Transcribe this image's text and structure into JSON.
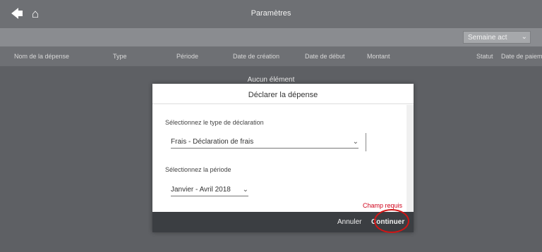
{
  "header": {
    "title": "Paramètres"
  },
  "toolbar": {
    "period_select": "Semaine act"
  },
  "table": {
    "columns": [
      "Nom de la dépense",
      "Type",
      "Période",
      "Date de création",
      "Date de début",
      "Montant",
      "Statut",
      "Date de paiement"
    ],
    "empty_text": "Aucun élément"
  },
  "modal": {
    "title": "Déclarer la dépense",
    "field1_label": "Sélectionnez le type de déclaration",
    "field1_value": "Frais - Déclaration de frais",
    "field2_label": "Sélectionnez la période",
    "field2_value": "Janvier - Avril 2018",
    "error_text": "Champ requis",
    "cancel_label": "Annuler",
    "continue_label": "Continuer"
  }
}
